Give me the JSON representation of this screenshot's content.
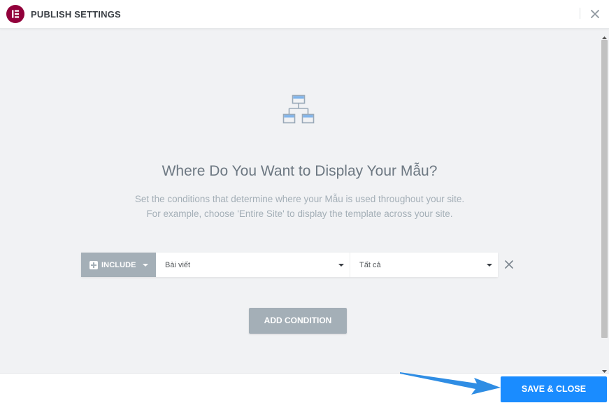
{
  "header": {
    "title": "PUBLISH SETTINGS",
    "logo_icon": "elementor-logo-icon",
    "close_icon": "close-icon"
  },
  "main": {
    "icon": "hierarchy-icon",
    "title": "Where Do You Want to Display Your Mẫu?",
    "description_line1": "Set the conditions that determine where your Mẫu is used throughout your site.",
    "description_line2": "For example, choose 'Entire Site' to display the template across your site."
  },
  "condition": {
    "type_label": "INCLUDE",
    "select1_value": "Bài viết",
    "select2_value": "Tất cả"
  },
  "buttons": {
    "add_condition": "ADD CONDITION",
    "save_close": "SAVE & CLOSE"
  },
  "colors": {
    "brand": "#92003b",
    "accent": "#1a8cff",
    "muted_button": "#a4afb7",
    "background": "#f1f2f4"
  }
}
